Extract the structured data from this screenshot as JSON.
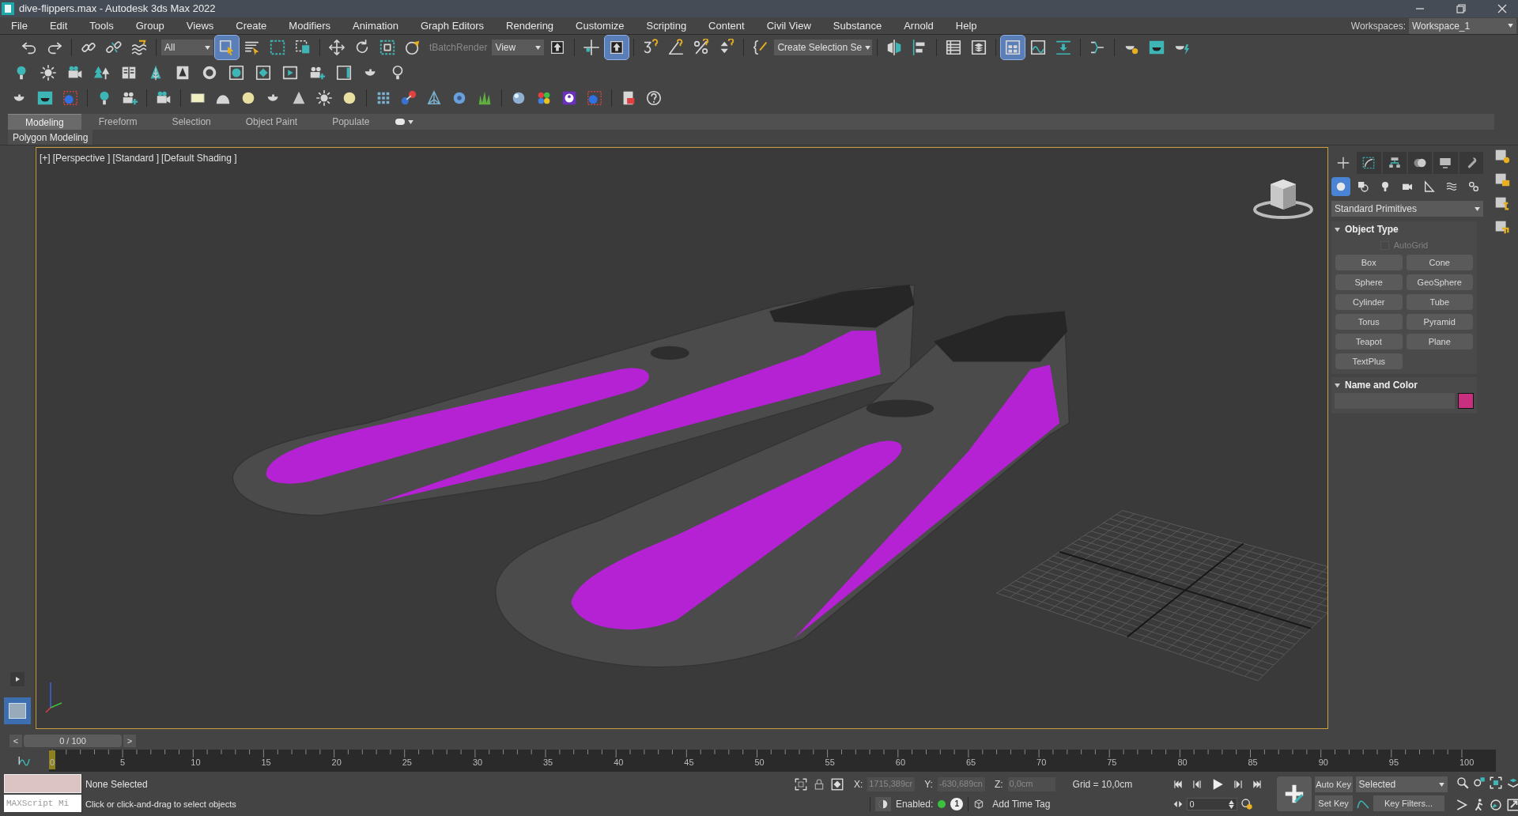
{
  "window": {
    "title": "dive-flippers.max - Autodesk 3ds Max 2022"
  },
  "menu": [
    "File",
    "Edit",
    "Tools",
    "Group",
    "Views",
    "Create",
    "Modifiers",
    "Animation",
    "Graph Editors",
    "Rendering",
    "Customize",
    "Scripting",
    "Content",
    "Civil View",
    "Substance",
    "Arnold",
    "Help"
  ],
  "workspaces": {
    "label": "Workspaces:",
    "value": "Workspace_1"
  },
  "main_toolbar": {
    "selection_filter": "All",
    "batch_render": "tBatchRender",
    "reference_coordinate": "View",
    "selection_set": "Create Selection Se",
    "toggles": [
      {
        "selected": true
      },
      {
        "selected": true
      },
      {
        "selected": true
      }
    ]
  },
  "ribbon": {
    "tabs": [
      {
        "label": "Modeling",
        "selected": true
      },
      {
        "label": "Freeform",
        "selected": false
      },
      {
        "label": "Selection",
        "selected": false
      },
      {
        "label": "Object Paint",
        "selected": false
      },
      {
        "label": "Populate",
        "selected": false
      }
    ],
    "panel": "Polygon Modeling"
  },
  "viewport": {
    "labels": [
      "[+]",
      "[Perspective ]",
      "[Standard ]",
      "[Default Shading ]"
    ],
    "active": true
  },
  "command_panel": {
    "tabs": [
      {
        "selected": true
      },
      {
        "selected": false
      },
      {
        "selected": false
      },
      {
        "selected": false
      },
      {
        "selected": false
      },
      {
        "selected": false
      }
    ],
    "categories": [
      {
        "selected": true
      },
      {
        "selected": false
      },
      {
        "selected": false
      },
      {
        "selected": false
      },
      {
        "selected": false
      },
      {
        "selected": false
      },
      {
        "selected": false
      }
    ],
    "dropdown": "Standard Primitives",
    "object_type": {
      "title": "Object Type",
      "expanded": true,
      "autogrid": {
        "label": "AutoGrid",
        "checked": false,
        "disabled": true
      },
      "buttons": [
        "Box",
        "Cone",
        "Sphere",
        "GeoSphere",
        "Cylinder",
        "Tube",
        "Torus",
        "Pyramid",
        "Teapot",
        "Plane",
        "TextPlus"
      ]
    },
    "name_and_color": {
      "title": "Name and Color",
      "expanded": true,
      "color": "#c8307f"
    }
  },
  "timeline": {
    "prev": "<",
    "frame": "0 / 100",
    "next": ">",
    "ticks": [
      "0",
      "5",
      "10",
      "15",
      "20",
      "25",
      "30",
      "35",
      "40",
      "45",
      "50",
      "55",
      "60",
      "65",
      "70",
      "75",
      "80",
      "85",
      "90",
      "95",
      "100"
    ]
  },
  "status": {
    "selection": "None Selected",
    "prompt": "Click or click-and-drag to select objects",
    "maxscript_placeholder": "MAXScript Mi",
    "coordinates": [
      {
        "axis": "X:",
        "value": "1715,389cr",
        "disabled": true
      },
      {
        "axis": "Y:",
        "value": "-630,689cn",
        "disabled": true
      },
      {
        "axis": "Z:",
        "value": "0,0cm",
        "disabled": true
      }
    ],
    "grid": "Grid = 10,0cm",
    "enabled_label": "Enabled:",
    "enabled_badge": "1",
    "time_tag": "Add Time Tag",
    "current_frame": "0",
    "auto_key": "Auto Key",
    "key_mode": "Selected",
    "set_key": "Set Key",
    "key_filters": "Key Filters..."
  }
}
